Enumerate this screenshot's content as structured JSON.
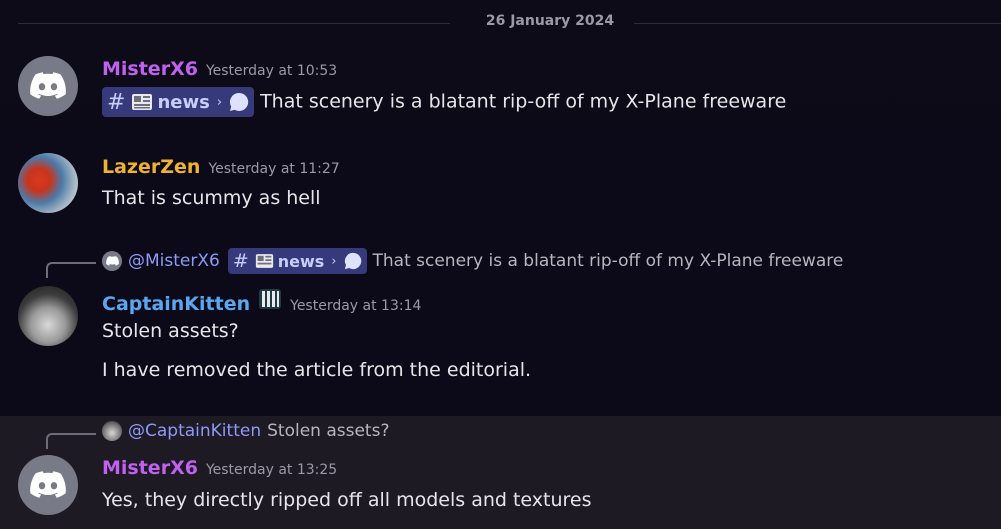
{
  "date_divider": "26 January 2024",
  "messages": [
    {
      "author": "MisterX6",
      "author_color": "#c061f0",
      "timestamp": "Yesterday at 10:53",
      "channel": {
        "name": "news"
      },
      "text": "That scenery is a blatant rip-off of my X-Plane freeware"
    },
    {
      "author": "LazerZen",
      "author_color": "#f0b232",
      "timestamp": "Yesterday at 11:27",
      "text": "That is scummy as hell"
    },
    {
      "reply": {
        "mention": "@MisterX6",
        "channel": "news",
        "text": "That scenery is a blatant rip-off of my X-Plane freeware"
      },
      "author": "CaptainKitten",
      "author_color": "#5aa7f0",
      "timestamp": "Yesterday at 13:14",
      "lines": [
        "Stolen assets?",
        "I have removed the article from the editorial."
      ]
    },
    {
      "reply": {
        "mention": "@CaptainKitten",
        "text": "Stolen assets?"
      },
      "author": "MisterX6",
      "author_color": "#c061f0",
      "timestamp": "Yesterday at 13:25",
      "text": "Yes, they directly ripped off all models and textures"
    }
  ]
}
